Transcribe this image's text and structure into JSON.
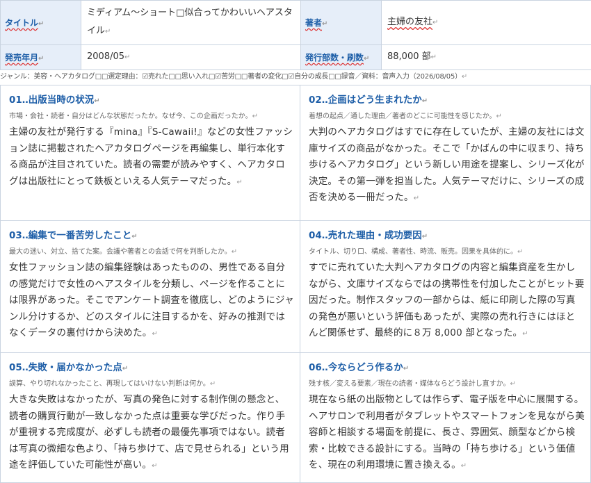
{
  "meta": {
    "title_label": "タイトル",
    "title_value": "ミディアム～ショート□似合ってかわいいヘアスタイル",
    "author_label": "著者",
    "author_value": "主婦の友社",
    "date_label": "発売年月",
    "date_value": "2008/05",
    "circulation_label": "発行部数・刷数",
    "circulation_value": "88,000 部"
  },
  "note": "ジャンル：美容・ヘアカタログ□□選定理由：☑売れた□□思い入れ□☑苦労□□著者の変化□☑自分の成長□□録音／資料：音声入力（2026/08/05）",
  "return_mark": "↵",
  "sections": [
    {
      "heading": "01‥出版当時の状況",
      "sub": "市場・会社・読者・自分はどんな状態だったか。なぜ今、この企画だったか。",
      "body": "主婦の友社が発行する『mina』『S-Cawaii!』などの女性ファッション誌に掲載されたヘアカタログページを再編集し、単行本化する商品が注目されていた。読者の需要が読みやすく、ヘアカタログは出版社にとって鉄板といえる人気テーマだった。"
    },
    {
      "heading": "02‥企画はどう生まれたか",
      "sub": "着想の起点／通した理由／著者のどこに可能性を感じたか。",
      "body": "大判のヘアカタログはすでに存在していたが、主婦の友社には文庫サイズの商品がなかった。そこで「かばんの中に収まり、持ち歩けるヘアカタログ」という新しい用途を提案し、シリーズ化が決定。その第一弾を担当した。人気テーマだけに、シリーズの成否を決める一冊だった。"
    },
    {
      "heading": "03‥編集で一番苦労したこと",
      "sub": "最大の迷い、対立、捨てた案。会議や著者との会話で何を判断したか。",
      "body": "女性ファッション誌の編集経験はあったものの、男性である自分の感覚だけで女性のヘアスタイルを分類し、ページを作ることには限界があった。そこでアンケート調査を徹底し、どのようにジャンル分けするか、どのスタイルに注目するかを、好みの推測ではなくデータの裏付けから決めた。"
    },
    {
      "heading": "04‥売れた理由・成功要因",
      "sub": "タイトル、切り口、構成、著者性、時流、販売。因果を具体的に。",
      "body": "すでに売れていた大判ヘアカタログの内容と編集資産を生かしながら、文庫サイズならではの携帯性を付加したことがヒット要因だった。制作スタッフの一部からは、紙に印刷した際の写真の発色が悪いという評価もあったが、実際の売れ行きにはほとんど関係せず、最終的に８万 8,000 部となった。"
    },
    {
      "heading": "05‥失敗・届かなかった点",
      "sub": "誤算、やり切れなかったこと、再現してはいけない判断は何か。",
      "body": "大きな失敗はなかったが、写真の発色に対する制作側の懸念と、読者の購買行動が一致しなかった点は重要な学びだった。作り手が重視する完成度が、必ずしも読者の最優先事項ではない。読者は写真の微細な色より、「持ち歩けて、店で見せられる」という用途を評価していた可能性が高い。"
    },
    {
      "heading": "06‥今ならどう作るか",
      "sub": "残す核／変える要素／現在の読者・媒体ならどう設計し直すか。",
      "body": "現在なら紙の出版物としては作らず、電子版を中心に展開する。ヘアサロンで利用者がタブレットやスマートフォンを見ながら美容師と相談する場面を前提に、長さ、雰囲気、顔型などから検索・比較できる設計にする。当時の「持ち歩ける」という価値を、現在の利用環境に置き換える。"
    }
  ]
}
